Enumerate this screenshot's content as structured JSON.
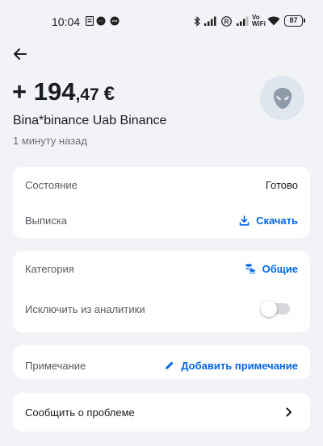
{
  "status_bar": {
    "time": "10:04",
    "battery": "87",
    "network_label": "Vo\nWiFi",
    "icons": [
      "sim-card-icon",
      "messenger-icon",
      "chat-bubble-icon",
      "bluetooth-icon",
      "signal-bars-icon",
      "r-roaming-icon",
      "signal-bars-icon",
      "vowifi-icon",
      "wifi-icon",
      "battery-icon"
    ]
  },
  "header": {
    "back_icon": "arrow-left-icon"
  },
  "transaction": {
    "amount_main": "+ 194",
    "amount_cents": ",47",
    "currency": "€",
    "merchant": "Bina*binance Uab Binance",
    "time_ago": "1 минуту назад",
    "avatar_icon": "alien-icon"
  },
  "details_card": {
    "status_label": "Состояние",
    "status_value": "Готово",
    "statement_label": "Выписка",
    "statement_action": "Скачать",
    "statement_icon": "download-icon"
  },
  "category_card": {
    "category_label": "Категория",
    "category_value": "Общие",
    "category_icon": "coins-stack-icon",
    "exclude_label": "Исключить из аналитики",
    "exclude_enabled": false
  },
  "note_card": {
    "note_label": "Примечание",
    "note_action": "Добавить примечание",
    "note_icon": "pencil-icon"
  },
  "report_card": {
    "label": "Сообщить о проблеме",
    "icon": "chevron-right-icon"
  },
  "colors": {
    "background": "#f2f3f7",
    "card": "#ffffff",
    "accent": "#0666eb",
    "primary_text": "#191c1f",
    "secondary_text": "#717173"
  }
}
